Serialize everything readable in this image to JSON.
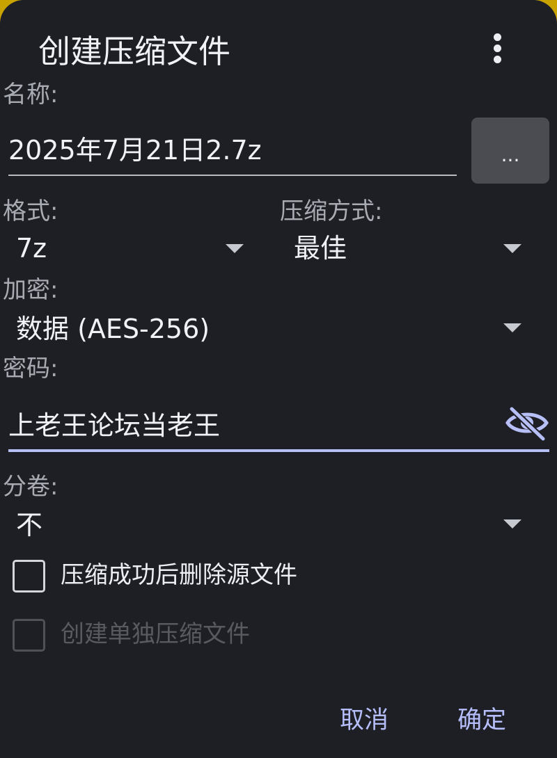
{
  "dialog": {
    "title": "创建压缩文件",
    "more_icon": "more-vert-icon"
  },
  "name": {
    "label": "名称:",
    "value": "2025年7月21日2.7z",
    "browse_label": "..."
  },
  "format": {
    "label": "格式:",
    "value": "7z"
  },
  "compression": {
    "label": "压缩方式:",
    "value": "最佳"
  },
  "encryption": {
    "label": "加密:",
    "value": "数据 (AES-256)"
  },
  "password": {
    "label": "密码:",
    "value": "上老王论坛当老王",
    "visibility_icon": "eye-off-icon"
  },
  "split": {
    "label": "分卷:",
    "value": "不"
  },
  "options": {
    "delete_source": "压缩成功后删除源文件",
    "separate_archives": "创建单独压缩文件"
  },
  "actions": {
    "cancel": "取消",
    "ok": "确定"
  },
  "colors": {
    "dialog_background": "#1e1f25",
    "accent": "#b5befa",
    "focused_underline": "#b7bff7"
  }
}
